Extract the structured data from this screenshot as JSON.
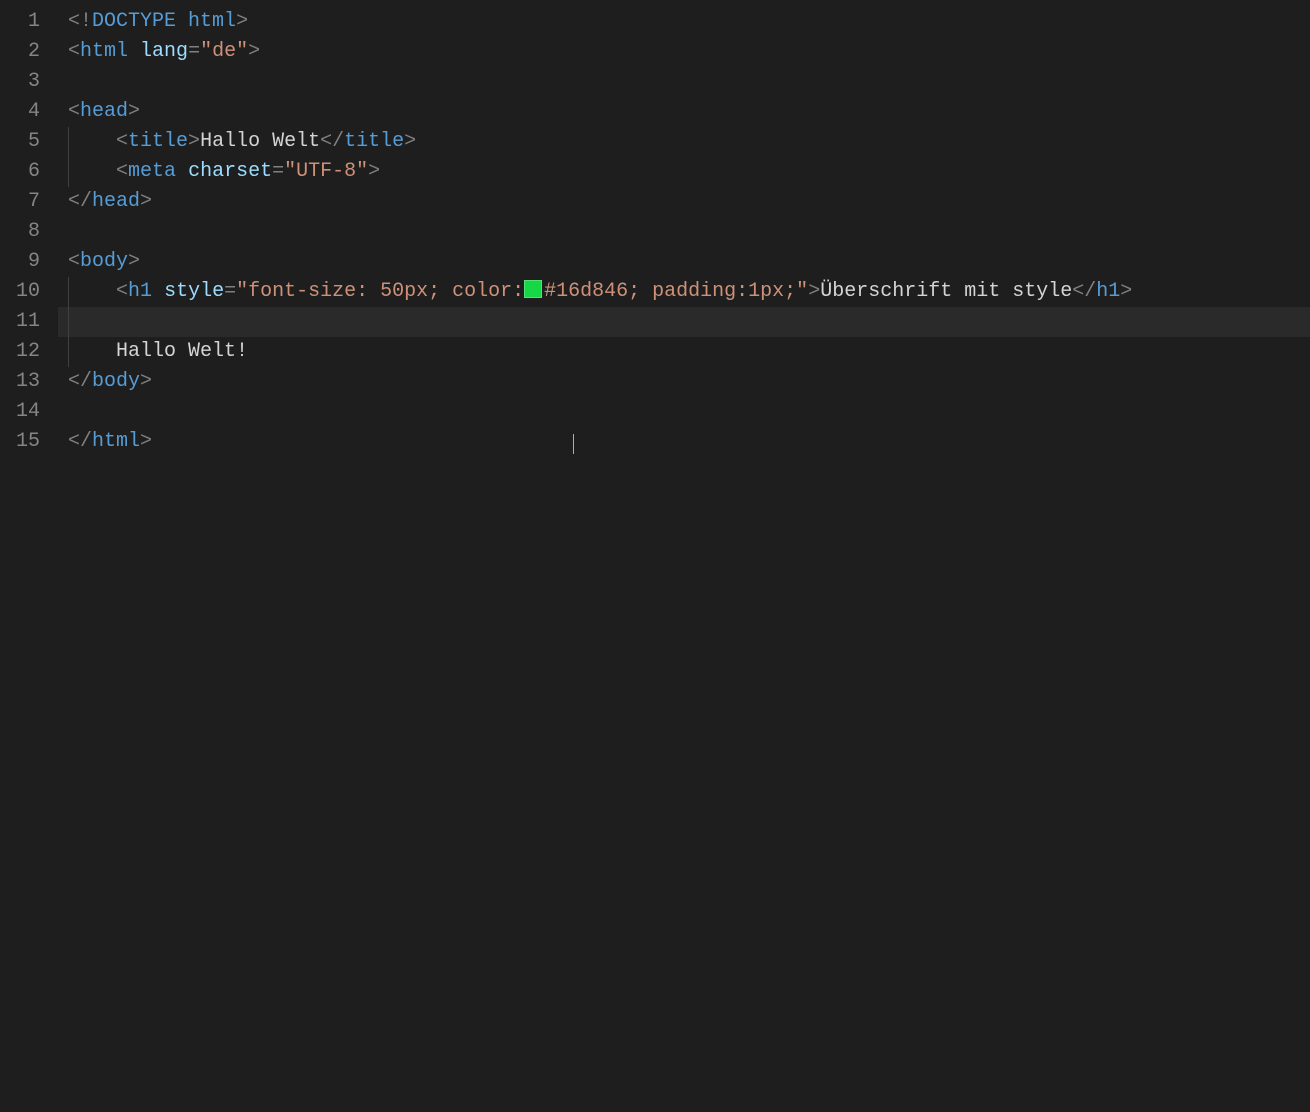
{
  "editor": {
    "lineCount": 15,
    "currentLine": 11,
    "cursor": {
      "line": 15,
      "colPx": 575
    },
    "colorSwatch": "#16d846",
    "lines": {
      "l1": {
        "doctype": "DOCTYPE",
        "html": "html"
      },
      "l2": {
        "tag": "html",
        "attr": "lang",
        "val": "\"de\""
      },
      "l4": {
        "tag": "head"
      },
      "l5": {
        "tag": "title",
        "text": "Hallo Welt"
      },
      "l6": {
        "tag": "meta",
        "attr": "charset",
        "val": "\"UTF-8\""
      },
      "l7": {
        "tag": "head"
      },
      "l9": {
        "tag": "body"
      },
      "l10": {
        "tag": "h1",
        "attr": "style",
        "val1": "\"font-size: 50px; color:",
        "valColor": "#16d846; padding:1px;\"",
        "text": "Überschrift mit style"
      },
      "l12": {
        "text": "Hallo Welt!"
      },
      "l13": {
        "tag": "body"
      },
      "l15": {
        "tag": "html"
      }
    }
  }
}
